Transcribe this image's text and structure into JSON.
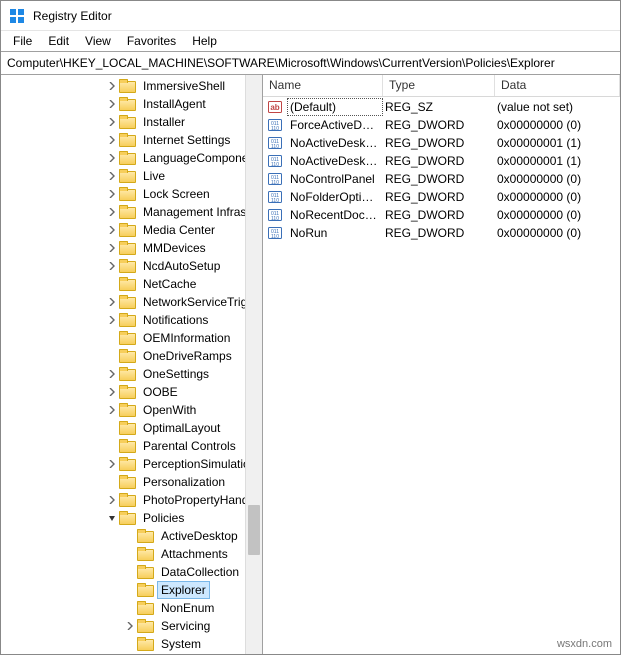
{
  "window": {
    "title": "Registry Editor"
  },
  "menu": {
    "file": "File",
    "edit": "Edit",
    "view": "View",
    "favorites": "Favorites",
    "help": "Help"
  },
  "address": "Computer\\HKEY_LOCAL_MACHINE\\SOFTWARE\\Microsoft\\Windows\\CurrentVersion\\Policies\\Explorer",
  "columns": {
    "name": "Name",
    "type": "Type",
    "data": "Data"
  },
  "tree": {
    "indent_base": 104,
    "items": [
      {
        "label": "ImmersiveShell",
        "depth": 0,
        "twisty": "closed"
      },
      {
        "label": "InstallAgent",
        "depth": 0,
        "twisty": "closed"
      },
      {
        "label": "Installer",
        "depth": 0,
        "twisty": "closed"
      },
      {
        "label": "Internet Settings",
        "depth": 0,
        "twisty": "closed"
      },
      {
        "label": "LanguageComponentsInstaller",
        "depth": 0,
        "twisty": "closed"
      },
      {
        "label": "Live",
        "depth": 0,
        "twisty": "closed"
      },
      {
        "label": "Lock Screen",
        "depth": 0,
        "twisty": "closed"
      },
      {
        "label": "Management Infrastructure",
        "depth": 0,
        "twisty": "closed"
      },
      {
        "label": "Media Center",
        "depth": 0,
        "twisty": "closed"
      },
      {
        "label": "MMDevices",
        "depth": 0,
        "twisty": "closed"
      },
      {
        "label": "NcdAutoSetup",
        "depth": 0,
        "twisty": "closed"
      },
      {
        "label": "NetCache",
        "depth": 0,
        "twisty": "none"
      },
      {
        "label": "NetworkServiceTriggers",
        "depth": 0,
        "twisty": "closed"
      },
      {
        "label": "Notifications",
        "depth": 0,
        "twisty": "closed"
      },
      {
        "label": "OEMInformation",
        "depth": 0,
        "twisty": "none"
      },
      {
        "label": "OneDriveRamps",
        "depth": 0,
        "twisty": "none"
      },
      {
        "label": "OneSettings",
        "depth": 0,
        "twisty": "closed"
      },
      {
        "label": "OOBE",
        "depth": 0,
        "twisty": "closed"
      },
      {
        "label": "OpenWith",
        "depth": 0,
        "twisty": "closed"
      },
      {
        "label": "OptimalLayout",
        "depth": 0,
        "twisty": "none"
      },
      {
        "label": "Parental Controls",
        "depth": 0,
        "twisty": "none"
      },
      {
        "label": "PerceptionSimulation",
        "depth": 0,
        "twisty": "closed"
      },
      {
        "label": "Personalization",
        "depth": 0,
        "twisty": "none"
      },
      {
        "label": "PhotoPropertyHandler",
        "depth": 0,
        "twisty": "closed"
      },
      {
        "label": "Policies",
        "depth": 0,
        "twisty": "open"
      },
      {
        "label": "ActiveDesktop",
        "depth": 1,
        "twisty": "none"
      },
      {
        "label": "Attachments",
        "depth": 1,
        "twisty": "none"
      },
      {
        "label": "DataCollection",
        "depth": 1,
        "twisty": "none"
      },
      {
        "label": "Explorer",
        "depth": 1,
        "twisty": "none",
        "selected": true
      },
      {
        "label": "NonEnum",
        "depth": 1,
        "twisty": "none"
      },
      {
        "label": "Servicing",
        "depth": 1,
        "twisty": "closed"
      },
      {
        "label": "System",
        "depth": 1,
        "twisty": "none"
      }
    ]
  },
  "values": [
    {
      "icon": "string",
      "name": "(Default)",
      "type": "REG_SZ",
      "data": "(value not set)",
      "focused": true
    },
    {
      "icon": "binary",
      "name": "ForceActiveDesk...",
      "type": "REG_DWORD",
      "data": "0x00000000 (0)"
    },
    {
      "icon": "binary",
      "name": "NoActiveDesktop",
      "type": "REG_DWORD",
      "data": "0x00000001 (1)"
    },
    {
      "icon": "binary",
      "name": "NoActiveDeskto...",
      "type": "REG_DWORD",
      "data": "0x00000001 (1)"
    },
    {
      "icon": "binary",
      "name": "NoControlPanel",
      "type": "REG_DWORD",
      "data": "0x00000000 (0)"
    },
    {
      "icon": "binary",
      "name": "NoFolderOptions",
      "type": "REG_DWORD",
      "data": "0x00000000 (0)"
    },
    {
      "icon": "binary",
      "name": "NoRecentDocsH...",
      "type": "REG_DWORD",
      "data": "0x00000000 (0)"
    },
    {
      "icon": "binary",
      "name": "NoRun",
      "type": "REG_DWORD",
      "data": "0x00000000 (0)"
    }
  ],
  "watermark": "wsxdn.com"
}
